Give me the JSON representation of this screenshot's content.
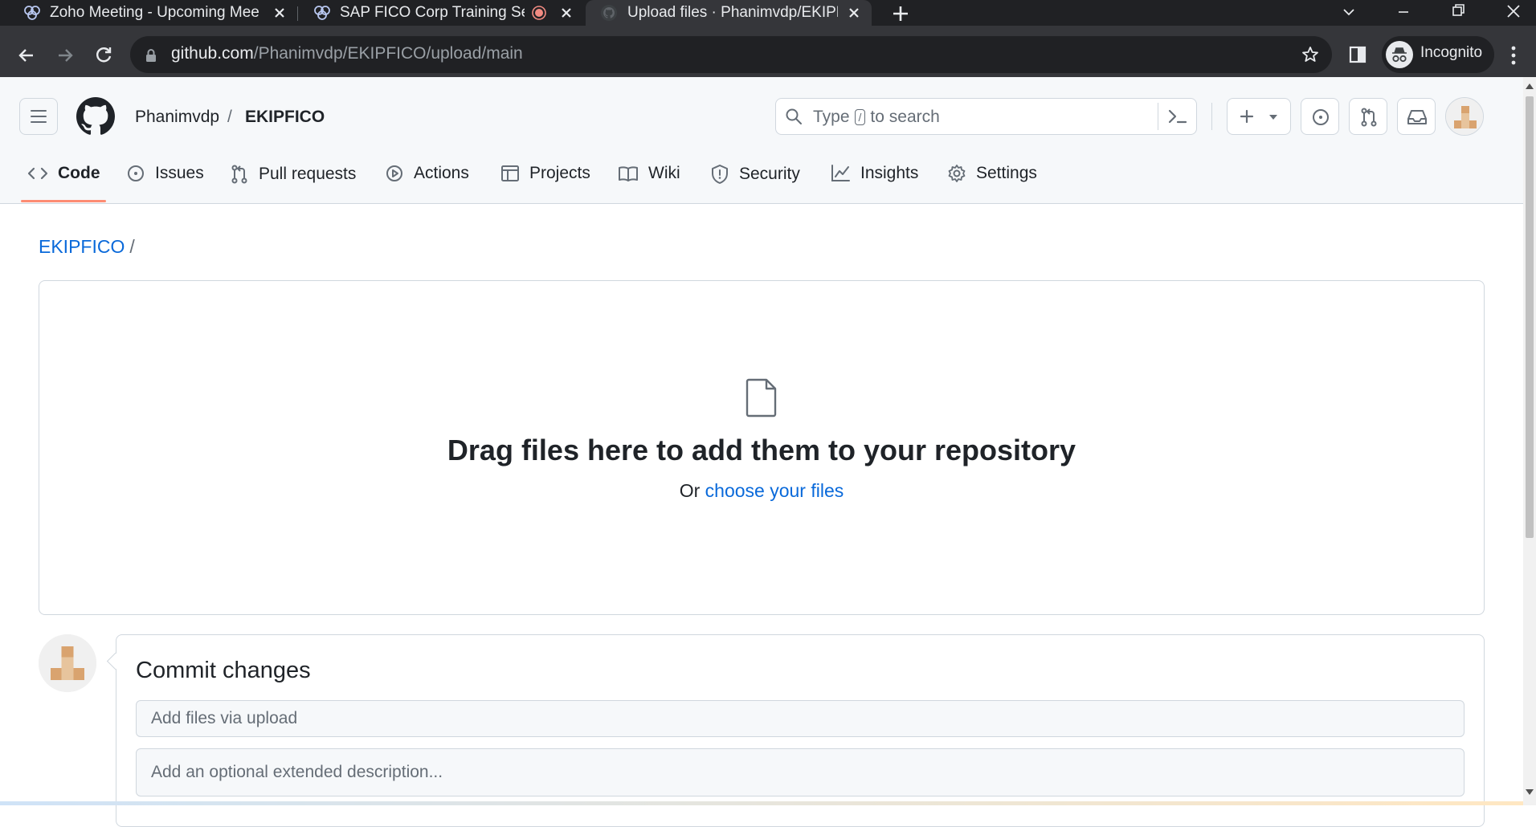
{
  "browser": {
    "tabs": [
      {
        "title": "Zoho Meeting - Upcoming Meeti",
        "icon": "zoho-icon",
        "active": false
      },
      {
        "title": "SAP FICO Corp Training Sessi",
        "icon": "zoho-icon",
        "active": false,
        "recording": true
      },
      {
        "title": "Upload files · Phanimvdp/EKIPFIC",
        "icon": "github-icon",
        "active": true
      }
    ],
    "url_host": "github.com",
    "url_path": "/Phanimvdp/EKIPFICO/upload/main",
    "profile_label": "Incognito"
  },
  "header": {
    "owner": "Phanimvdp",
    "separator": "/",
    "repo": "EKIPFICO",
    "search_placeholder_before": "Type",
    "search_key": "/",
    "search_placeholder_after": "to search"
  },
  "repo_nav": [
    {
      "label": "Code",
      "icon": "code-icon",
      "selected": true
    },
    {
      "label": "Issues",
      "icon": "issue-opened-icon"
    },
    {
      "label": "Pull requests",
      "icon": "git-pull-request-icon"
    },
    {
      "label": "Actions",
      "icon": "play-icon"
    },
    {
      "label": "Projects",
      "icon": "table-icon"
    },
    {
      "label": "Wiki",
      "icon": "book-icon"
    },
    {
      "label": "Security",
      "icon": "shield-icon"
    },
    {
      "label": "Insights",
      "icon": "graph-icon"
    },
    {
      "label": "Settings",
      "icon": "gear-icon"
    }
  ],
  "breadcrumb": {
    "repo": "EKIPFICO",
    "separator": "/"
  },
  "dropzone": {
    "title": "Drag files here to add them to your repository",
    "or_text": "Or",
    "choose_link": "choose your files"
  },
  "commit": {
    "title": "Commit changes",
    "summary_placeholder": "Add files via upload",
    "description_placeholder": "Add an optional extended description..."
  },
  "colors": {
    "chrome_dark": "#202124",
    "chrome_toolbar": "#35363a",
    "link": "#0969da",
    "tab_underline": "#fd8c73",
    "border": "#d0d7de"
  }
}
